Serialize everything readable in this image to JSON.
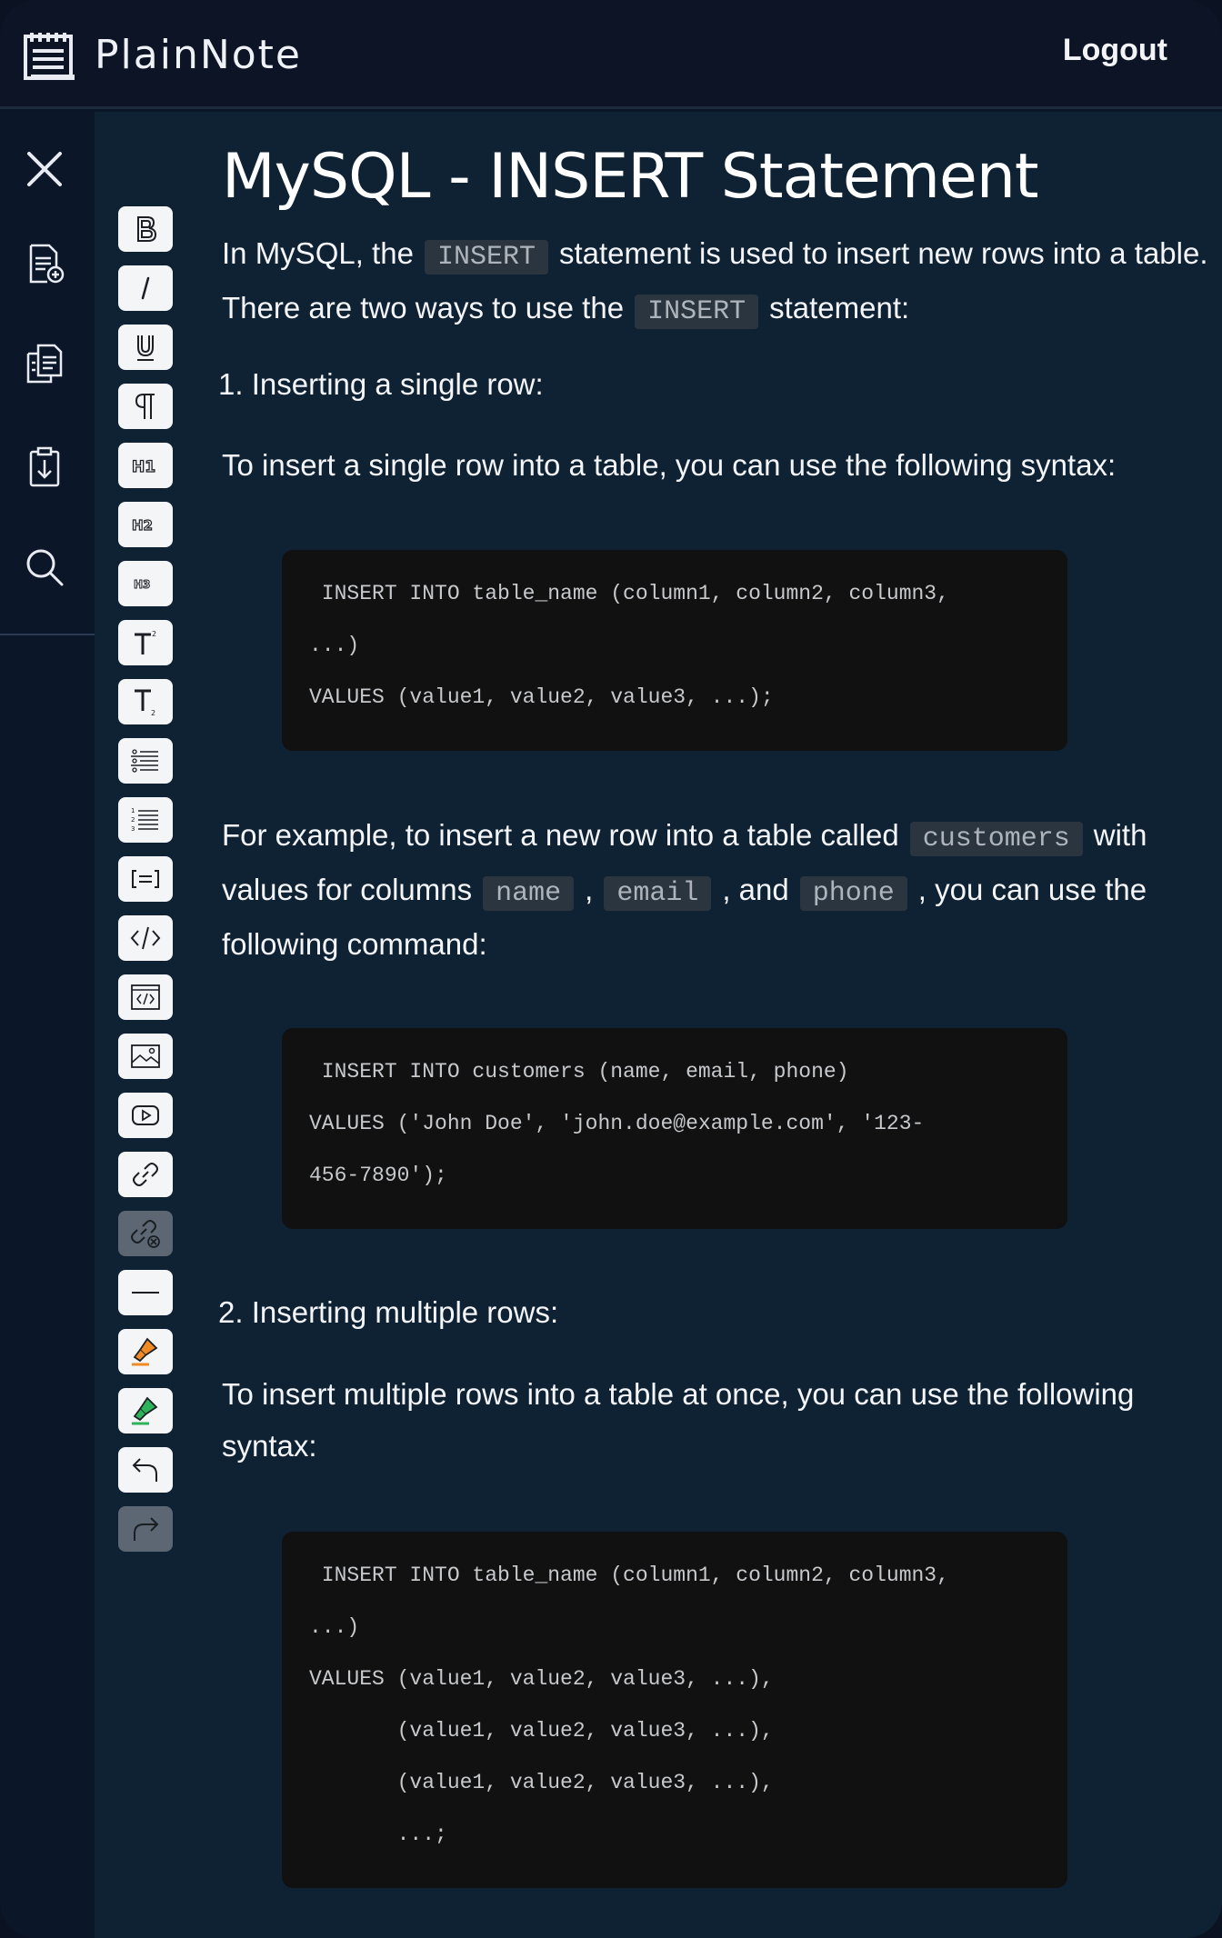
{
  "header": {
    "app_name": "PlainNote",
    "logout_label": "Logout"
  },
  "leftnav": {
    "items": [
      {
        "name": "close-icon"
      },
      {
        "name": "new-note-icon"
      },
      {
        "name": "notes-list-icon"
      },
      {
        "name": "import-icon"
      },
      {
        "name": "search-icon"
      }
    ]
  },
  "toolbar": {
    "buttons": [
      {
        "name": "bold-icon",
        "disabled": false
      },
      {
        "name": "italic-icon",
        "disabled": false
      },
      {
        "name": "underline-icon",
        "disabled": false
      },
      {
        "name": "paragraph-icon",
        "disabled": false
      },
      {
        "name": "heading1-icon",
        "disabled": false
      },
      {
        "name": "heading2-icon",
        "disabled": false
      },
      {
        "name": "heading3-icon",
        "disabled": false
      },
      {
        "name": "superscript-icon",
        "disabled": false
      },
      {
        "name": "subscript-icon",
        "disabled": false
      },
      {
        "name": "bullet-list-icon",
        "disabled": false
      },
      {
        "name": "numbered-list-icon",
        "disabled": false
      },
      {
        "name": "blockquote-icon",
        "disabled": false
      },
      {
        "name": "inline-code-icon",
        "disabled": false
      },
      {
        "name": "code-block-icon",
        "disabled": false
      },
      {
        "name": "image-icon",
        "disabled": false
      },
      {
        "name": "video-icon",
        "disabled": false
      },
      {
        "name": "link-icon",
        "disabled": false
      },
      {
        "name": "unlink-icon",
        "disabled": true
      },
      {
        "name": "horizontal-rule-icon",
        "disabled": false
      },
      {
        "name": "highlight-orange-icon",
        "disabled": false
      },
      {
        "name": "highlight-green-icon",
        "disabled": false
      },
      {
        "name": "undo-icon",
        "disabled": false
      },
      {
        "name": "redo-icon",
        "disabled": true
      }
    ],
    "highlight_colors": {
      "orange": "#f08a24",
      "green": "#2fb35a"
    }
  },
  "document": {
    "title": "MySQL - INSERT Statement",
    "intro": {
      "p1_a": "In MySQL, the",
      "p1_code": "INSERT",
      "p1_b": "statement is used to insert new rows into a table.",
      "p2_a": "There are two ways to use the",
      "p2_code": "INSERT",
      "p2_b": "statement:"
    },
    "section1_heading": "1. Inserting a single row:",
    "section1_text": "To insert a single row into a table, you can use the following syntax:",
    "code1": [
      " INSERT INTO table_name (column1, column2, column3,",
      "...)",
      "VALUES (value1, value2, value3, ...);"
    ],
    "example": {
      "a": "For example, to insert a new row into a table called",
      "code_customers": "customers",
      "b": "with",
      "c": "values for columns",
      "code_name": "name",
      "comma1": ",",
      "code_email": "email",
      "d": ", and",
      "code_phone": "phone",
      "e": ", you can use the",
      "f": "following command:"
    },
    "code2": [
      " INSERT INTO customers (name, email, phone)",
      "VALUES ('John Doe', 'john.doe@example.com', '123-",
      "456-7890');"
    ],
    "section2_heading": "2. Inserting multiple rows:",
    "section2_text_a": "To insert multiple rows into a table at once, you can use the following",
    "section2_text_b": "syntax:",
    "code3": [
      " INSERT INTO table_name (column1, column2, column3,",
      "...)",
      "VALUES (value1, value2, value3, ...),",
      "       (value1, value2, value3, ...),",
      "       (value1, value2, value3, ...),",
      "       ...;"
    ]
  }
}
